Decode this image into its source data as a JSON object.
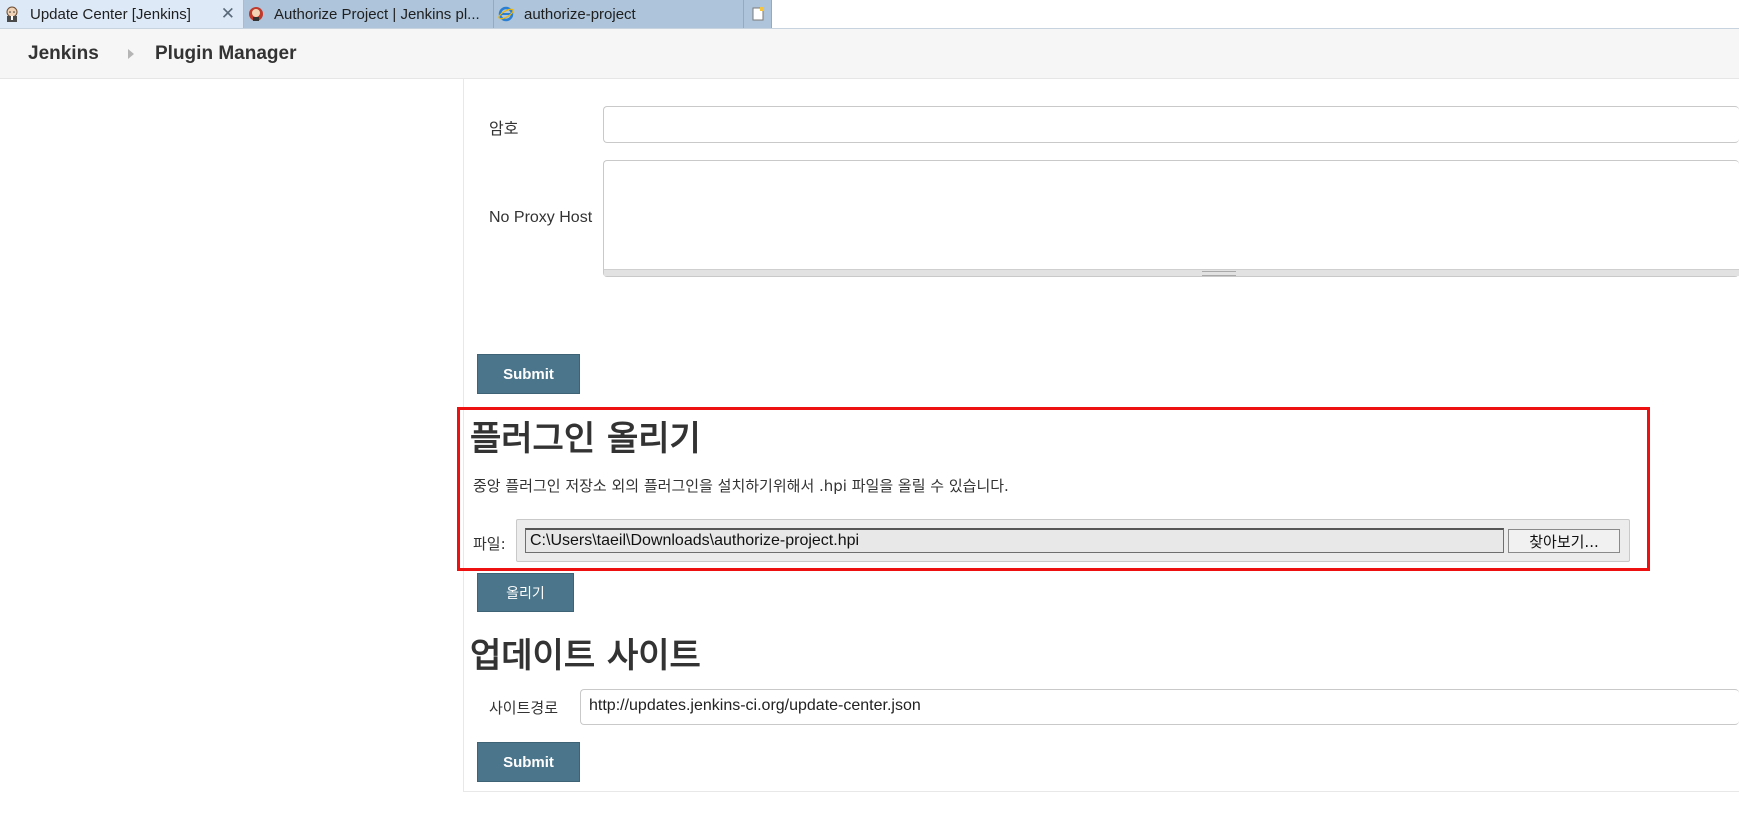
{
  "browser": {
    "tabs": [
      {
        "title": "Update Center [Jenkins]",
        "icon": "jenkins-butler-icon",
        "active": true
      },
      {
        "title": "Authorize Project | Jenkins pl...",
        "icon": "jenkins-logo-icon",
        "active": false
      },
      {
        "title": "authorize-project",
        "icon": "ie-browser-icon",
        "active": false
      }
    ],
    "close_glyph": "✕"
  },
  "breadcrumb": {
    "home": "Jenkins",
    "current": "Plugin Manager"
  },
  "proxy_form": {
    "password_label": "암호",
    "password_value": "",
    "no_proxy_label": "No Proxy Host",
    "no_proxy_value": "",
    "submit_label": "Submit"
  },
  "upload_plugin": {
    "title": "플러그인 올리기",
    "description": "중앙 플러그인 저장소 외의 플러그인을 설치하기위해서 .hpi 파일을 올릴 수 있습니다.",
    "file_label": "파일:",
    "file_path": "C:\\Users\\taeil\\Downloads\\authorize-project.hpi",
    "browse_label": "찾아보기...",
    "upload_label": "올리기"
  },
  "update_site": {
    "title": "업데이트 사이트",
    "url_label": "사이트경로",
    "url_value": "http://updates.jenkins-ci.org/update-center.json",
    "submit_label": "Submit"
  },
  "colors": {
    "button": "#4b758b",
    "highlight": "#ee1111",
    "active_tab": "#dde9f7",
    "inactive_tab": "#adc4da"
  }
}
